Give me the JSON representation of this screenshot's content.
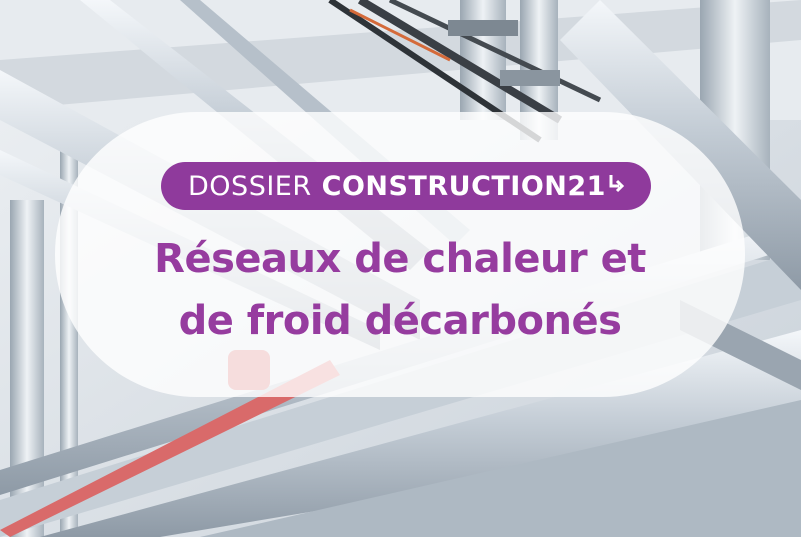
{
  "colors": {
    "accent": "#8f3a9c",
    "title": "#963c9f",
    "overlay": "#ffffff"
  },
  "badge": {
    "prefix": "DOSSIER",
    "brand": "CONSTRUCTION21",
    "arrow_icon": "arrow-corner-icon"
  },
  "title": {
    "line1": "Réseaux de chaleur et",
    "line2": "de froid décarbonés"
  }
}
